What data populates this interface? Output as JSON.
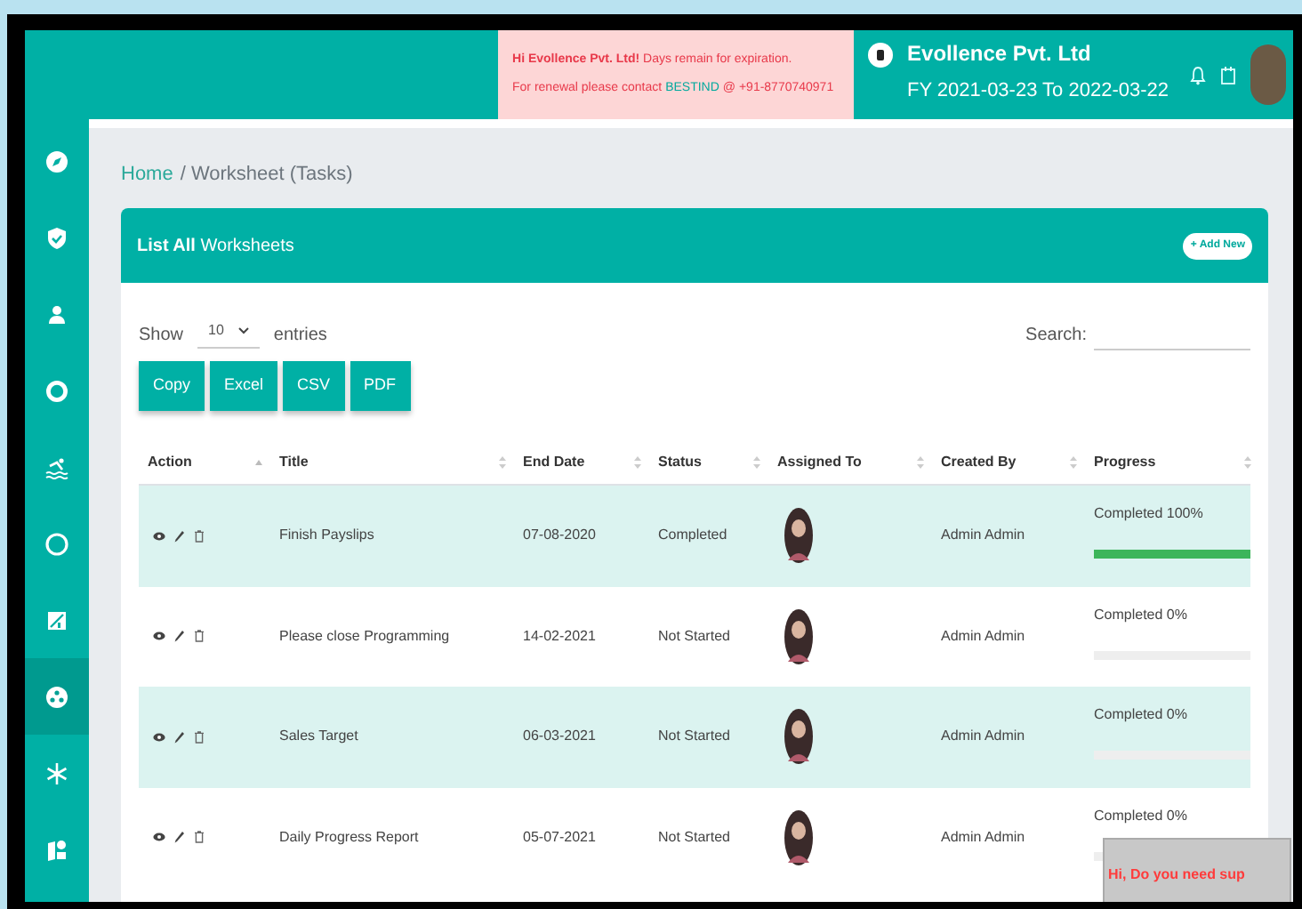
{
  "header": {
    "notice_line_1": "**Hi Evollence Pvt. Ltd!** Days remain for expiration.",
    "notice_line_2_prefix": "For renewal please contact",
    "notice_link": "BESTIND",
    "notice_line_2_suffix": "@ +91-8770740971",
    "company": "Evollence Pvt. Ltd",
    "fiscal_year": "FY 2021-03-23 To 2022-03-22"
  },
  "sidebar": {
    "items": [
      {
        "selected": false
      },
      {
        "selected": false
      },
      {
        "selected": false
      },
      {
        "selected": false
      },
      {
        "selected": false
      },
      {
        "selected": false
      },
      {
        "selected": false
      },
      {
        "selected": true
      },
      {
        "selected": false
      },
      {
        "selected": false
      }
    ]
  },
  "breadcrumb": {
    "home": "Home",
    "current": "/ Worksheet (Tasks)"
  },
  "card": {
    "title": "**List All** Worksheets",
    "add_button": "+ Add New"
  },
  "controls": {
    "show": "Show",
    "entries_value": "10",
    "entries": "entries",
    "search_label": "Search:",
    "buttons": [
      "Copy",
      "Excel",
      "CSV",
      "PDF"
    ]
  },
  "table": {
    "columns": [
      "Action",
      "Title",
      "End Date",
      "Status",
      "Assigned To",
      "Created By",
      "Progress"
    ],
    "rows": [
      {
        "title": "Finish Payslips",
        "end_date": "07-08-2020",
        "status": "Completed",
        "created_by": "Admin Admin",
        "progress": "Completed 100%",
        "level": 1
      },
      {
        "title": "Please close Programming",
        "end_date": "14-02-2021",
        "status": "Not Started",
        "created_by": "Admin Admin",
        "progress": "Completed 0%",
        "level": 0
      },
      {
        "title": "Sales Target",
        "end_date": "06-03-2021",
        "status": "Not Started",
        "created_by": "Admin Admin",
        "progress": "Completed 0%",
        "level": 0
      },
      {
        "title": "Daily Progress Report",
        "end_date": "05-07-2021",
        "status": "Not Started",
        "created_by": "Admin Admin",
        "progress": "Completed 0%",
        "level": 0
      }
    ]
  },
  "chat_popup": {
    "text": "Hi, Do you need sup"
  }
}
